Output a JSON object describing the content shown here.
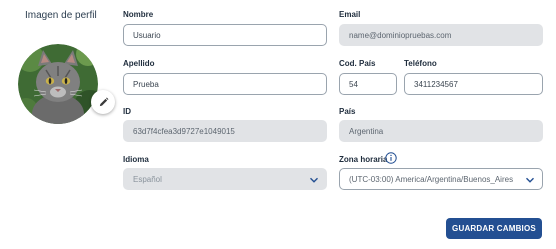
{
  "profile": {
    "title": "Imagen de perfil",
    "avatar_icon": "cat-photo",
    "edit_icon": "pencil-icon"
  },
  "form": {
    "nombre": {
      "label": "Nombre",
      "value": "Usuario"
    },
    "email": {
      "label": "Email",
      "value": "name@dominiopruebas.com"
    },
    "apellido": {
      "label": "Apellido",
      "value": "Prueba"
    },
    "cod_pais": {
      "label": "Cod. País",
      "value": "54"
    },
    "telefono": {
      "label": "Teléfono",
      "value": "3411234567"
    },
    "id": {
      "label": "ID",
      "value": "63d7f4cfea3d9727e1049015"
    },
    "pais": {
      "label": "País",
      "value": "Argentina"
    },
    "idioma": {
      "label": "Idioma",
      "value": "Español"
    },
    "zona_horaria": {
      "label": "Zona horaria",
      "value": "(UTC-03:00) America/Argentina/Buenos_Aires"
    }
  },
  "actions": {
    "save_label": "GUARDAR CAMBIOS"
  },
  "colors": {
    "primary": "#234f92",
    "readonly_bg": "#e1e3e6",
    "border": "#9aa4ae"
  }
}
